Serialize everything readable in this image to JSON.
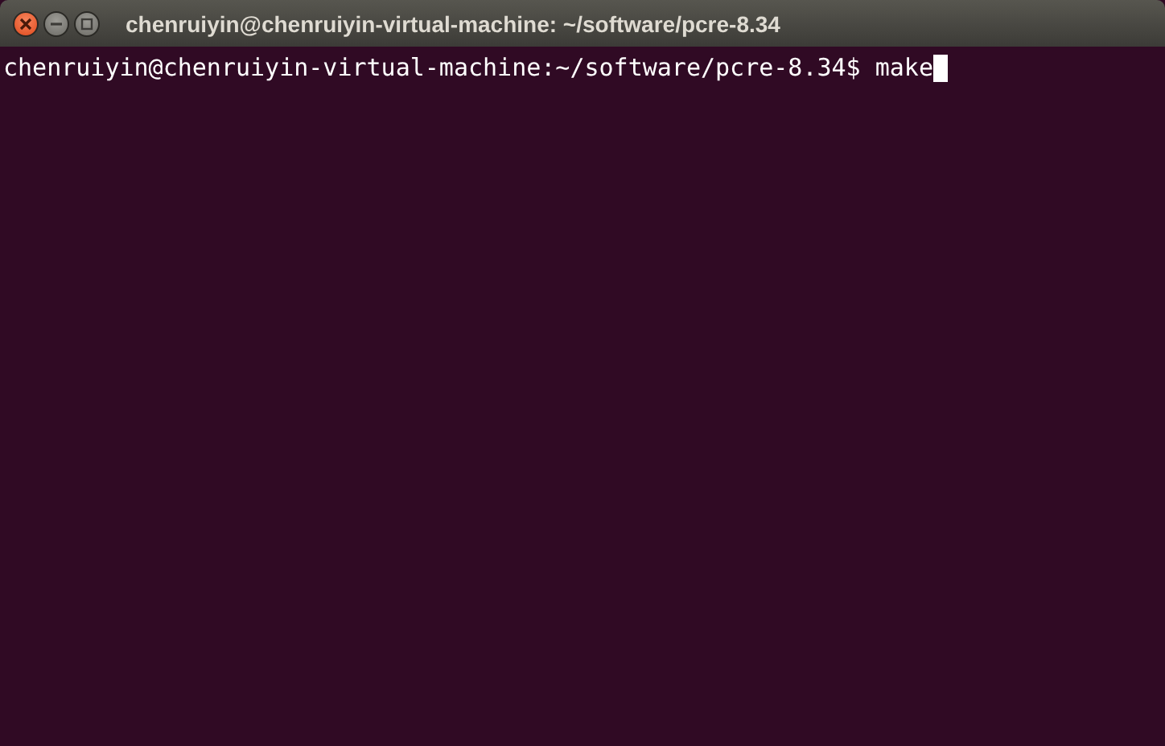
{
  "window": {
    "title": "chenruiyin@chenruiyin-virtual-machine: ~/software/pcre-8.34"
  },
  "terminal": {
    "lines": [
      {
        "prompt": "chenruiyin@chenruiyin-virtual-machine:~/software/pcre-8.34$",
        "command": "make",
        "cursor": true
      }
    ]
  }
}
